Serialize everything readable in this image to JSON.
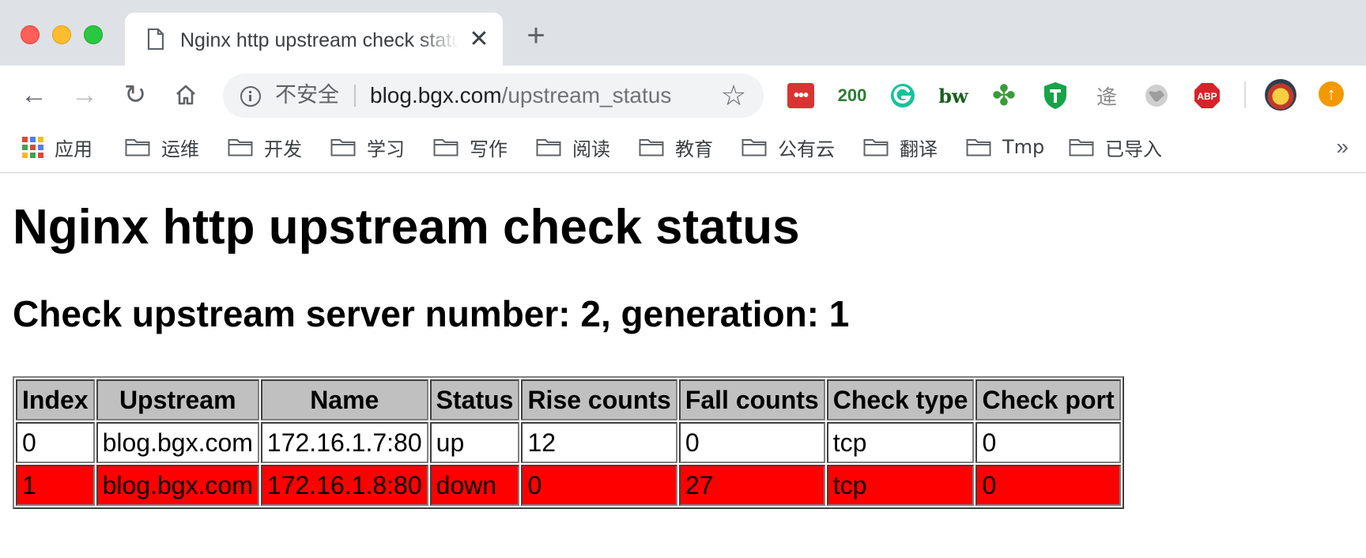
{
  "browser": {
    "tab": {
      "title": "Nginx http upstream check status",
      "close_glyph": "✕"
    },
    "new_tab_glyph": "+",
    "nav": {
      "back": "←",
      "forward": "→",
      "reload": "↻",
      "home": "⌂"
    },
    "omnibox": {
      "security_label": "不安全",
      "url_host": "blog.bgx.com",
      "url_path": "/upstream_status",
      "bookmark_glyph": "☆"
    },
    "extensions": {
      "pocket": "•••",
      "counter": "200",
      "g": "G",
      "bw": "bw",
      "clover": "✤",
      "cal": "逄",
      "abp": "ABP",
      "update": "↑"
    },
    "icons": [
      "page-icon",
      "info-icon",
      "star-icon",
      "folder-icon",
      "apps-icon",
      "avatar",
      "update-icon"
    ]
  },
  "bookmarks": {
    "apps_label": "应用",
    "folders": [
      "运维",
      "开发",
      "学习",
      "写作",
      "阅读",
      "教育",
      "公有云",
      "翻译",
      "Tmp",
      "已导入"
    ],
    "overflow": "»"
  },
  "page": {
    "title": "Nginx http upstream check status",
    "subtitle": "Check upstream server number: 2, generation: 1",
    "table": {
      "headers": [
        "Index",
        "Upstream",
        "Name",
        "Status",
        "Rise counts",
        "Fall counts",
        "Check type",
        "Check port"
      ],
      "rows": [
        [
          "0",
          "blog.bgx.com",
          "172.16.1.7:80",
          "up",
          "12",
          "0",
          "tcp",
          "0"
        ],
        [
          "1",
          "blog.bgx.com",
          "172.16.1.8:80",
          "down",
          "0",
          "27",
          "tcp",
          "0"
        ]
      ]
    },
    "colors": {
      "down_row": "#ff0000",
      "header_bg": "#c0c0c0"
    }
  }
}
